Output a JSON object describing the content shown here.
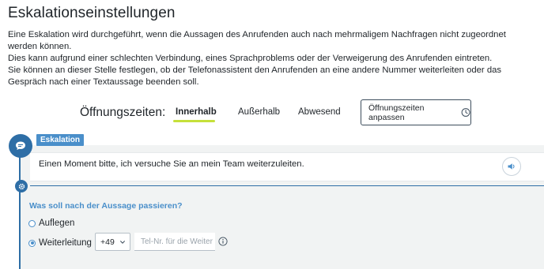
{
  "page": {
    "title": "Eskalationseinstellungen",
    "description": [
      "Eine Eskalation wird durchgeführt, wenn die Aussagen des Anrufenden auch nach mehrmaligem Nachfragen nicht zugeordnet werden können.",
      "Dies kann aufgrund einer schlechten Verbindung, eines Sprachproblems oder der Verweigerung des Anrufenden eintreten.",
      "Sie können an dieser Stelle festlegen, ob der Telefonassistent den Anrufenden an eine andere Nummer weiterleiten oder das Gespräch nach einer Textaussage beenden soll."
    ]
  },
  "hours": {
    "label": "Öffnungszeiten:",
    "tabs": [
      {
        "label": "Innerhalb",
        "active": true
      },
      {
        "label": "Außerhalb",
        "active": false
      },
      {
        "label": "Abwesend",
        "active": false
      }
    ],
    "adjust_button": "Öffnungszeiten anpassen"
  },
  "escalation": {
    "badge": "Eskalation",
    "message": "Einen Moment bitte, ich versuche Sie an mein Team weiterzuleiten.",
    "question": "Was soll nach der Aussage passieren?",
    "options": [
      {
        "label": "Auflegen",
        "selected": false
      },
      {
        "label": "Weiterleitung",
        "selected": true
      }
    ],
    "country_code": "+49",
    "phone_placeholder": "Tel-Nr. für die Weiter",
    "phone_value": ""
  },
  "colors": {
    "accent": "#2e6ea6",
    "badge": "#4a8fca",
    "active_underline": "#c6e03a",
    "panel_bg": "#f1f3f3"
  },
  "icons": {
    "chat": "chat-bubble-icon",
    "gear": "gear-icon",
    "speaker": "speaker-icon",
    "clock": "clock-icon",
    "chevron": "chevron-down-icon",
    "info": "info-icon"
  }
}
